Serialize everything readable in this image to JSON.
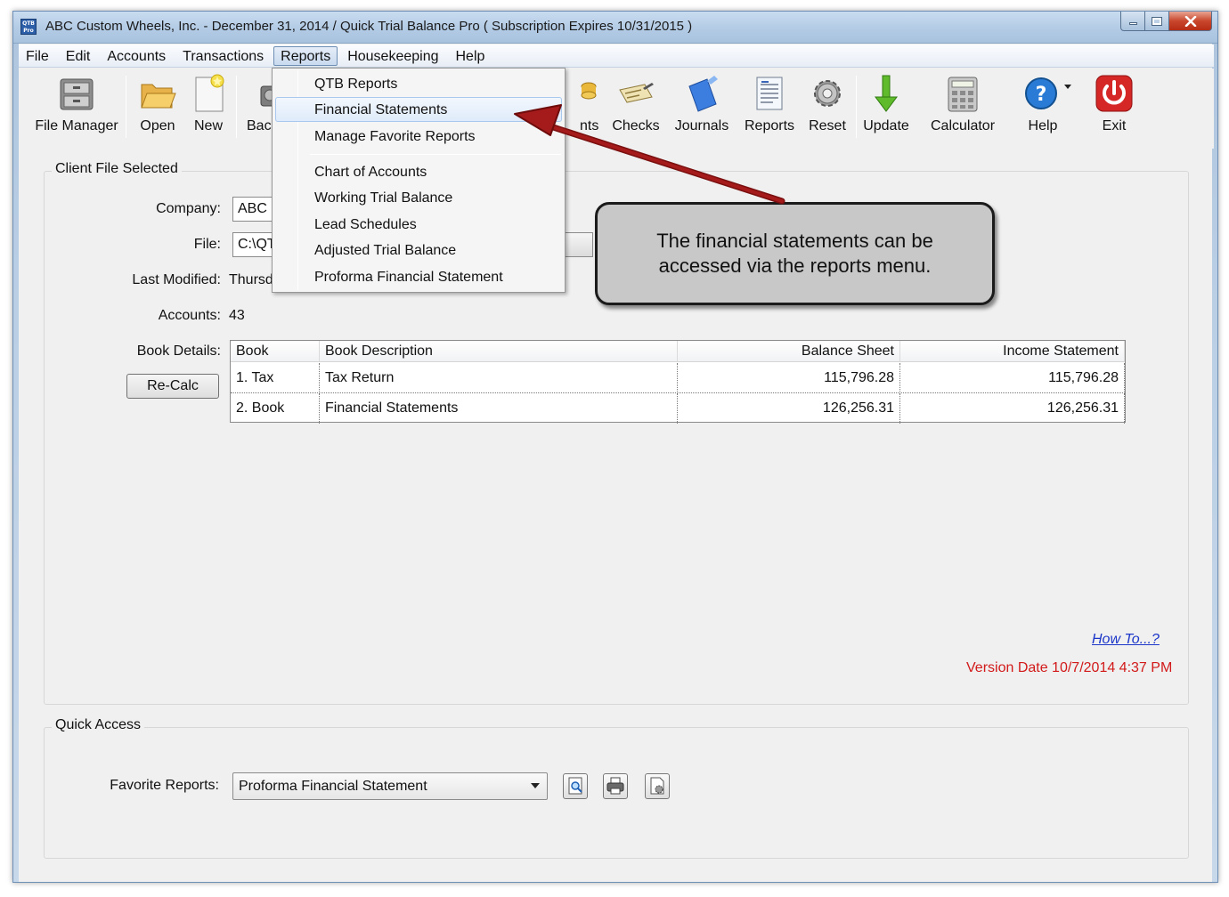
{
  "window": {
    "title": "ABC Custom Wheels, Inc. - December 31, 2014 / Quick Trial Balance Pro ( Subscription Expires 10/31/2015 )",
    "app_icon_text": "QTB",
    "app_icon_sub": "Pro"
  },
  "menu": [
    "File",
    "Edit",
    "Accounts",
    "Transactions",
    "Reports",
    "Housekeeping",
    "Help"
  ],
  "toolbar": {
    "file_manager": "File Manager",
    "open": "Open",
    "new": "New",
    "backup": "Bacl",
    "prints": "nts",
    "checks": "Checks",
    "journals": "Journals",
    "reports": "Reports",
    "reset": "Reset",
    "update": "Update",
    "calculator": "Calculator",
    "help": "Help",
    "exit": "Exit"
  },
  "reports_menu": {
    "items": [
      "QTB Reports",
      "Financial Statements",
      "Manage Favorite Reports",
      "Chart of Accounts",
      "Working Trial Balance",
      "Lead Schedules",
      "Adjusted Trial Balance",
      "Proforma Financial Statement"
    ],
    "highlighted": "Financial Statements"
  },
  "client_file": {
    "group_title": "Client File Selected",
    "company_label": "Company:",
    "company_value": "ABC C",
    "file_label": "File:",
    "file_value": "C:\\QT",
    "last_modified_label": "Last Modified:",
    "last_modified_value": "Thursd",
    "accounts_label": "Accounts:",
    "accounts_value": "43",
    "book_details_label": "Book Details:",
    "recalc_label": "Re-Calc"
  },
  "book_table": {
    "columns": [
      "Book",
      "Book Description",
      "Balance Sheet",
      "Income Statement"
    ],
    "rows": [
      {
        "book": "1. Tax",
        "description": "Tax Return",
        "balance_sheet": "115,796.28",
        "income_statement": "115,796.28"
      },
      {
        "book": "2. Book",
        "description": "Financial Statements",
        "balance_sheet": "126,256.31",
        "income_statement": "126,256.31"
      }
    ]
  },
  "callout": {
    "text": "The financial statements can be accessed via the reports menu."
  },
  "links": {
    "how_to": "How To...?",
    "version": "Version Date 10/7/2014 4:37 PM"
  },
  "quick_access": {
    "group_title": "Quick Access",
    "favorite_label": "Favorite Reports:",
    "favorite_value": "Proforma Financial Statement"
  },
  "colors": {
    "link": "#1b36c9",
    "version": "#d21a1a",
    "arrow": "#8b1212",
    "callout_bg": "#c8c8c8"
  }
}
